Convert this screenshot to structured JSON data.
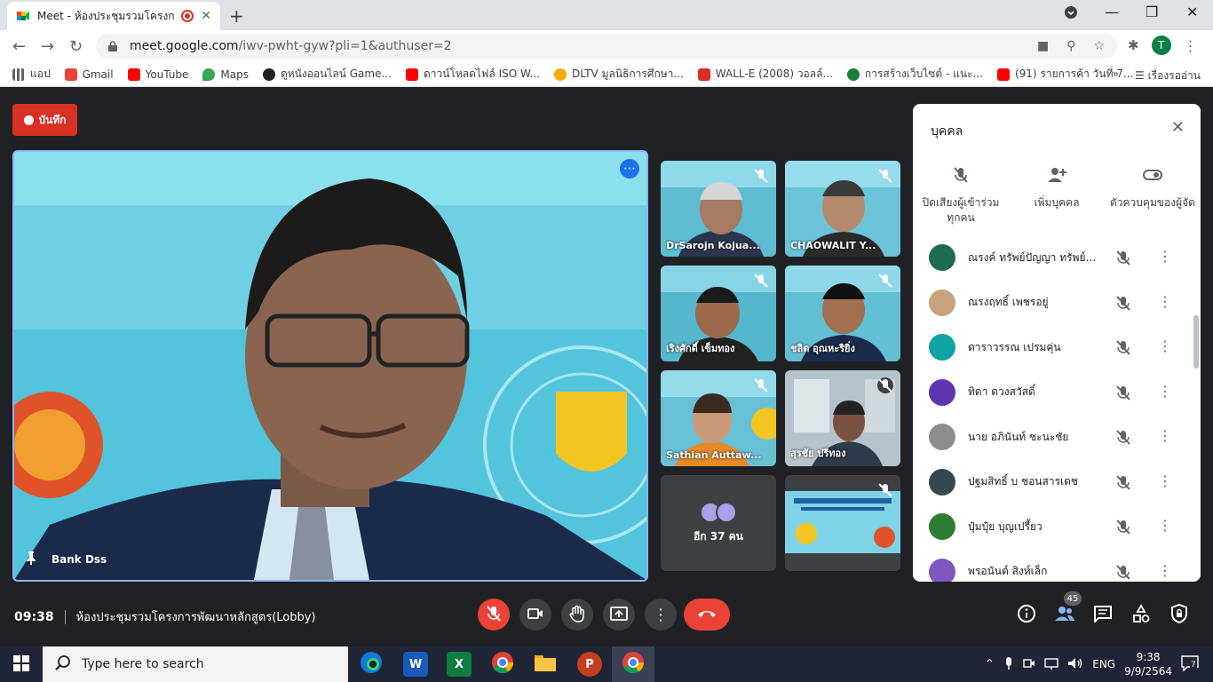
{
  "browser": {
    "tab_title": "Meet - ห้องประชุมรวมโครงการพั",
    "url_host": "meet.google.com",
    "url_path": "/iwv-pwht-gyw?pli=1&authuser=2",
    "profile_initial": "T"
  },
  "bookmarks": [
    {
      "label": "แอป",
      "color": "#5f6368"
    },
    {
      "label": "Gmail",
      "color": "#ea4335"
    },
    {
      "label": "YouTube",
      "color": "#ff0000"
    },
    {
      "label": "Maps",
      "color": "#34a853"
    },
    {
      "label": "ดูหนังออนไลน์ Game...",
      "color": "#202124"
    },
    {
      "label": "ดาวน์โหลดไฟล์ ISO W...",
      "color": "#ff0000"
    },
    {
      "label": "DLTV มูลนิธิการศึกษา...",
      "color": "#f9ab00"
    },
    {
      "label": "WALL-E (2008) วอลล์...",
      "color": "#d93025"
    },
    {
      "label": "การสร้างเว็บไซต์ - แนะ...",
      "color": "#188038"
    },
    {
      "label": "(91) รายการค้า วันที่ 7...",
      "color": "#ff0000"
    }
  ],
  "bookmarks_more": "»",
  "reading_list": "เรื่องรออ่าน",
  "meet": {
    "record_label": "บันทึก",
    "main_speaker": "Bank Dss",
    "time": "09:38",
    "meeting_title": "ห้องประชุมรวมโครงการพัฒนาหลักสูตร(Lobby)",
    "participant_count": "45"
  },
  "tiles": [
    {
      "name": "DrSarojn Kojua...",
      "bg": "#5fbdd2"
    },
    {
      "name": "CHAOWALIT Y...",
      "bg": "#6cc3d8"
    },
    {
      "name": "เริงศักดิ์ เข็มทอง",
      "bg": "#55b7cc"
    },
    {
      "name": "ชลิต อุณหะริยิ่ง",
      "bg": "#63bfd4"
    },
    {
      "name": "Sathian Auttaw...",
      "bg": "#68c0d4"
    },
    {
      "name": "สุรชัย ปรีทอง",
      "bg": "#b7c3cc"
    }
  ],
  "more_tile_label": "อีก 37 คน",
  "panel": {
    "title": "บุคคล",
    "actions": [
      {
        "label": "ปิดเสียงผู้เข้าร่วมทุกคน"
      },
      {
        "label": "เพิ่มบุคคล"
      },
      {
        "label": "ตัวควบคุมของผู้จัด"
      }
    ],
    "people": [
      {
        "name": "ณรงค์ ทรัพย์ปัญญา ทรัพย์ปั...",
        "avatar": "#1e6b52"
      },
      {
        "name": "ณรงฤทธิ์ เพชรอยู่",
        "avatar": "#c8a27a"
      },
      {
        "name": "ดาราวรรณ เปรมคุ่น",
        "avatar": "#12a4a4"
      },
      {
        "name": "ทิดา ดวงสวัสดิ์",
        "avatar": "#5e35b1"
      },
      {
        "name": "นาย อภินันท์ ชะนะชัย",
        "avatar": "#8d8d8d"
      },
      {
        "name": "ปฐมสิทธิ์ บ ชอนสารเดช",
        "avatar": "#37474f"
      },
      {
        "name": "ปุ๋มปุ๋ย บุญเปรี้ยว",
        "avatar": "#2e7d32"
      },
      {
        "name": "พรอนันต์ สิงห์เล็ก",
        "avatar": "#7e57c2"
      }
    ]
  },
  "taskbar": {
    "search_placeholder": "Type here to search",
    "lang": "ENG",
    "clock_time": "9:38",
    "clock_date": "9/9/2564",
    "notifications": "7"
  }
}
